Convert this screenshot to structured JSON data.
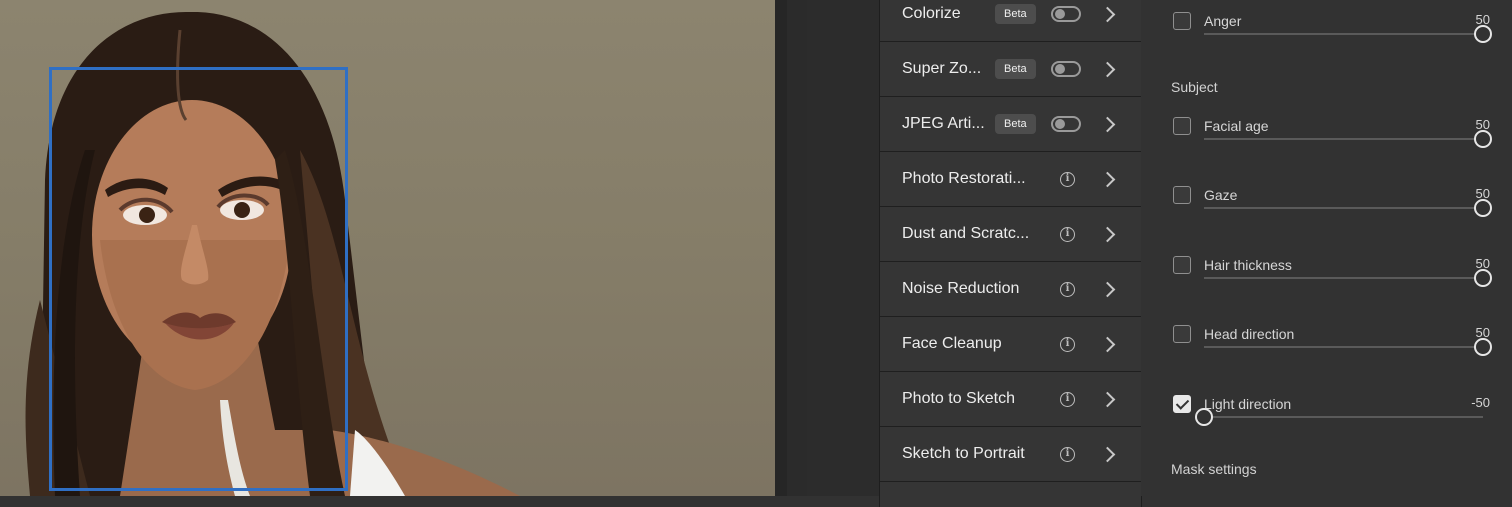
{
  "filters": [
    {
      "label": "Colorize",
      "badge": "Beta",
      "control": "toggle"
    },
    {
      "label": "Super Zo...",
      "badge": "Beta",
      "control": "toggle"
    },
    {
      "label": "JPEG Arti...",
      "badge": "Beta",
      "control": "toggle"
    },
    {
      "label": "Photo Restorati...",
      "control": "info"
    },
    {
      "label": "Dust and Scratc...",
      "control": "info"
    },
    {
      "label": "Noise Reduction",
      "control": "info"
    },
    {
      "label": "Face Cleanup",
      "control": "info"
    },
    {
      "label": "Photo to Sketch",
      "control": "info"
    },
    {
      "label": "Sketch to Portrait",
      "control": "info"
    }
  ],
  "settings": {
    "emotion_rows": [
      {
        "label": "Anger",
        "value": "50",
        "checked": false,
        "level": 1.0
      }
    ],
    "subject_title": "Subject",
    "subject_rows": [
      {
        "label": "Facial age",
        "value": "50",
        "checked": false,
        "level": 1.0
      },
      {
        "label": "Gaze",
        "value": "50",
        "checked": false,
        "level": 1.0
      },
      {
        "label": "Hair thickness",
        "value": "50",
        "checked": false,
        "level": 1.0
      },
      {
        "label": "Head direction",
        "value": "50",
        "checked": false,
        "level": 1.0
      },
      {
        "label": "Light direction",
        "value": "-50",
        "checked": true,
        "level": 0.0
      }
    ],
    "mask_title": "Mask settings"
  },
  "icons": {
    "info": "info-icon",
    "chevron": "chevron-right-icon"
  },
  "colors": {
    "face_box": "#2f6fc4",
    "panel_bg": "#323232",
    "list_bg": "#353535"
  }
}
